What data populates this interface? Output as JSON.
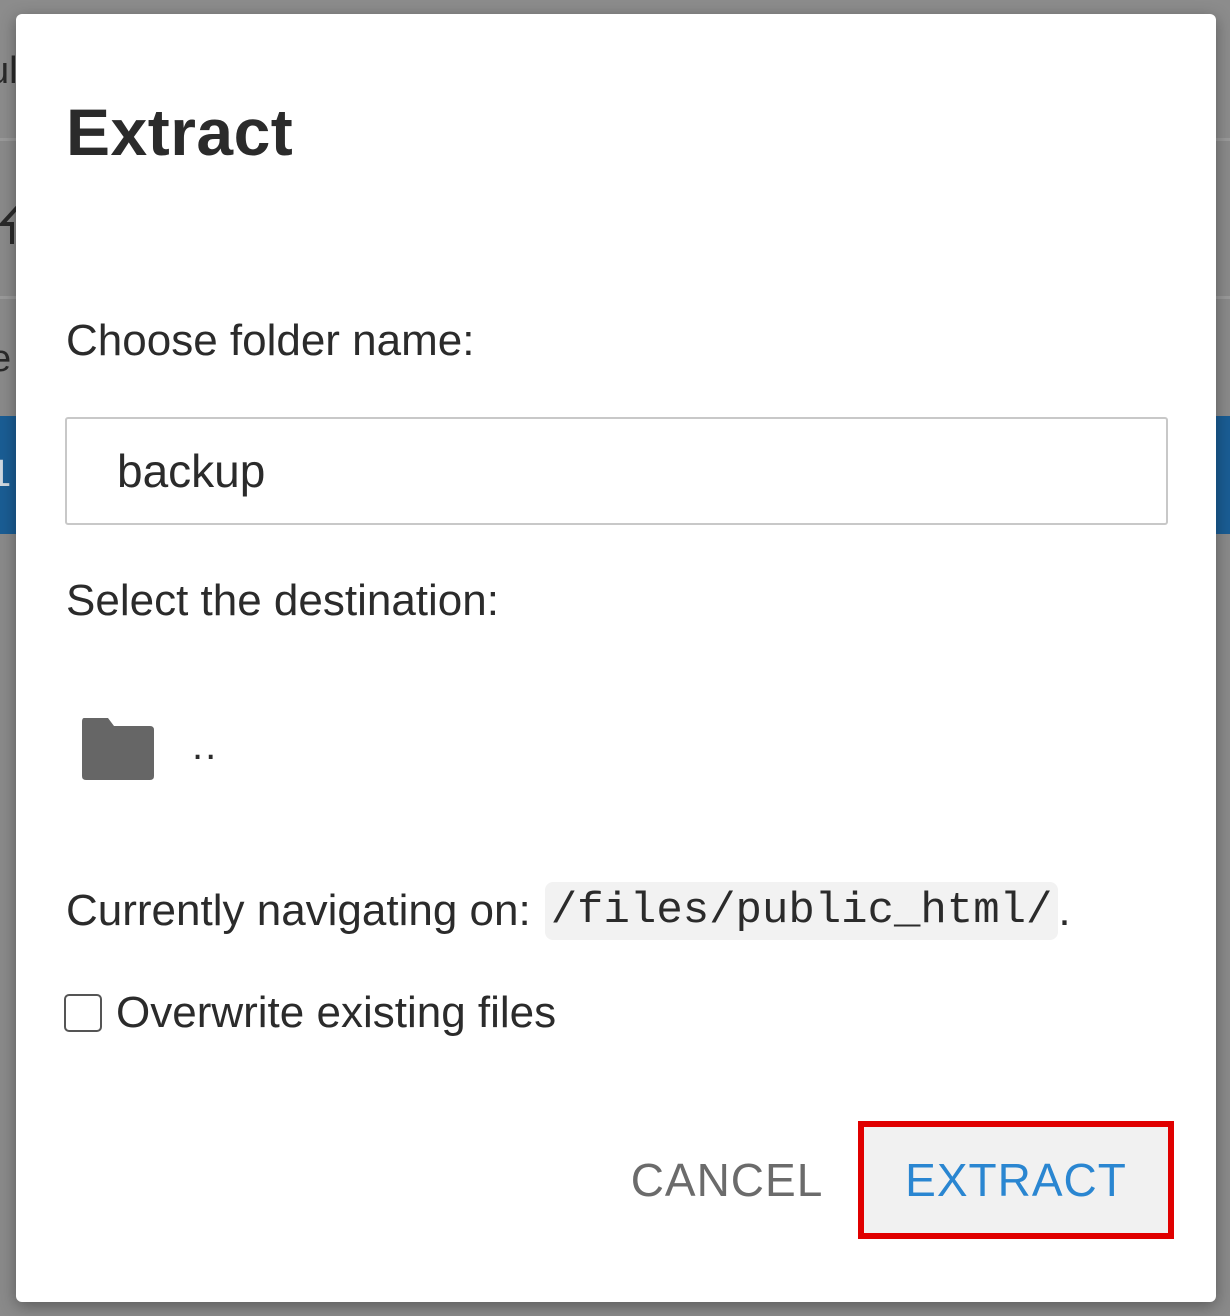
{
  "dialog": {
    "title": "Extract",
    "folder_label": "Choose folder name:",
    "folder_value": "backup",
    "destination_label": "Select the destination:",
    "directory_items": [
      {
        "name": "..",
        "icon": "folder-icon"
      }
    ],
    "navigating_prefix": "Currently navigating on:",
    "current_path": "/files/public_html/",
    "navigating_suffix": ".",
    "overwrite_label": "Overwrite existing files",
    "overwrite_checked": false,
    "cancel_label": "CANCEL",
    "extract_label": "EXTRACT"
  },
  "background": {
    "glyph_top": "ul",
    "glyph_mid": "e",
    "glyph_row": "1"
  },
  "colors": {
    "accent": "#2a86d1",
    "highlight_box": "#e00000",
    "selected_row": "#1a5d94",
    "text": "#2b2b2b",
    "muted_button": "#6b6b6b"
  }
}
